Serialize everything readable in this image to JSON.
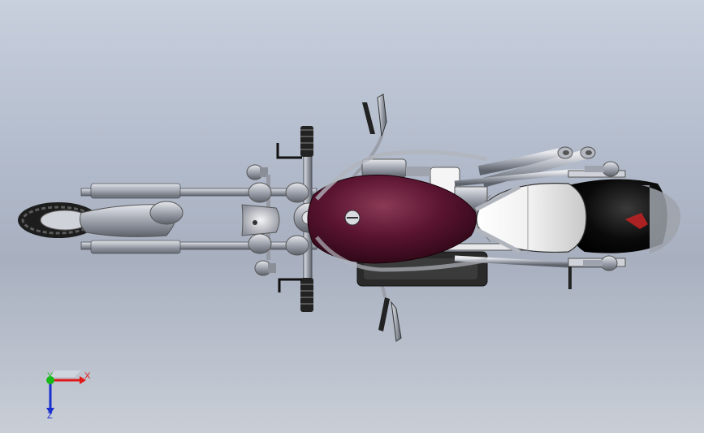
{
  "viewport": {
    "background_top": "#c8d0de",
    "background_bottom": "#c9ced6"
  },
  "model": {
    "tank_color": "#4a0f22",
    "seat_color": "#f2f2f2",
    "fender_color": "#000000",
    "frame_color": "#b5b9c2"
  },
  "triad": {
    "x_label": "X",
    "y_label": "Y",
    "z_label": "Z",
    "x_color": "#e01818",
    "y_color": "#18b818",
    "z_color": "#1a2fd0"
  }
}
